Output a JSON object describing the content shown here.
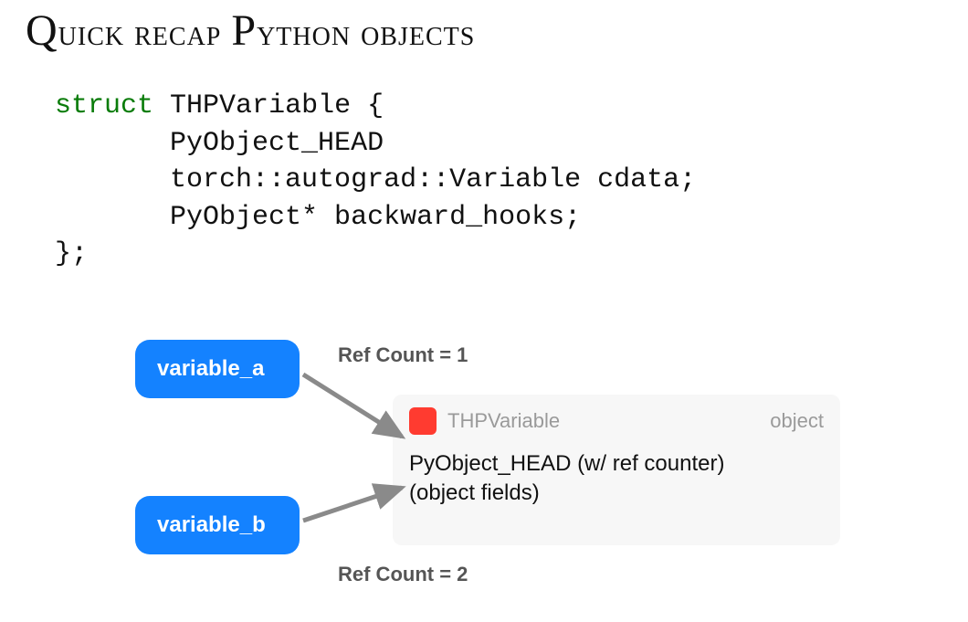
{
  "title": {
    "word1_cap": "Q",
    "word1_rest": "uick recap ",
    "word2_cap": "P",
    "word2_rest": "ython objects"
  },
  "code": {
    "kw": "struct",
    "name": "THPVariable",
    "line1": "PyObject_HEAD",
    "line2": "torch::autograd::Variable cdata;",
    "line3": "PyObject* backward_hooks;"
  },
  "diagram": {
    "var_a": "variable_a",
    "var_b": "variable_b",
    "ref1": "Ref Count = 1",
    "ref2": "Ref Count = 2",
    "object_card": {
      "type_name": "THPVariable",
      "kind_label": "object",
      "body_line1": "PyObject_HEAD (w/ ref counter)",
      "body_line2": "(object fields)"
    }
  }
}
